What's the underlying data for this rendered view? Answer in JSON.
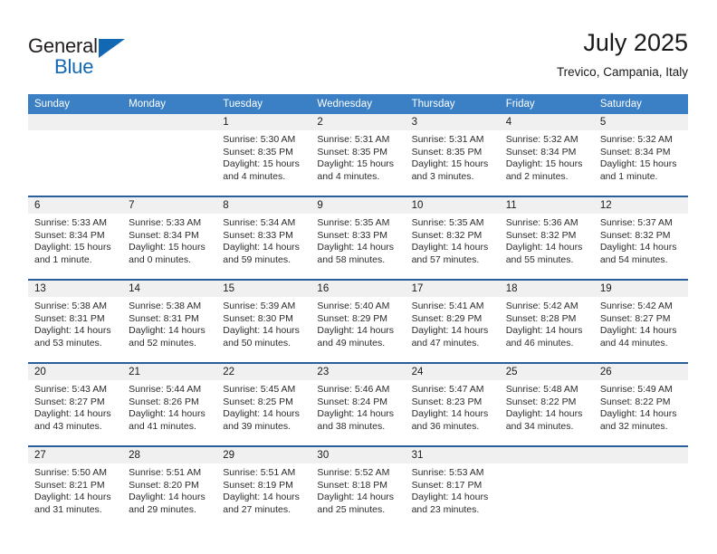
{
  "brand": {
    "name_part1": "General",
    "name_part2": "Blue",
    "triangle_color": "#1268b3",
    "text_color": "#231f20"
  },
  "header": {
    "title": "July 2025",
    "subtitle": "Trevico, Campania, Italy"
  },
  "theme": {
    "header_blue": "#3b7fc4",
    "row_rule_blue": "#2a6099",
    "daynum_band": "#f0f0f0",
    "background": "#ffffff"
  },
  "weekdays": [
    "Sunday",
    "Monday",
    "Tuesday",
    "Wednesday",
    "Thursday",
    "Friday",
    "Saturday"
  ],
  "labels": {
    "sunrise": "Sunrise:",
    "sunset": "Sunset:",
    "daylight": "Daylight:"
  },
  "weeks": [
    [
      {
        "day": "",
        "empty": true
      },
      {
        "day": "",
        "empty": true
      },
      {
        "day": "1",
        "sunrise": "Sunrise: 5:30 AM",
        "sunset": "Sunset: 8:35 PM",
        "daylight1": "Daylight: 15 hours",
        "daylight2": "and 4 minutes."
      },
      {
        "day": "2",
        "sunrise": "Sunrise: 5:31 AM",
        "sunset": "Sunset: 8:35 PM",
        "daylight1": "Daylight: 15 hours",
        "daylight2": "and 4 minutes."
      },
      {
        "day": "3",
        "sunrise": "Sunrise: 5:31 AM",
        "sunset": "Sunset: 8:35 PM",
        "daylight1": "Daylight: 15 hours",
        "daylight2": "and 3 minutes."
      },
      {
        "day": "4",
        "sunrise": "Sunrise: 5:32 AM",
        "sunset": "Sunset: 8:34 PM",
        "daylight1": "Daylight: 15 hours",
        "daylight2": "and 2 minutes."
      },
      {
        "day": "5",
        "sunrise": "Sunrise: 5:32 AM",
        "sunset": "Sunset: 8:34 PM",
        "daylight1": "Daylight: 15 hours",
        "daylight2": "and 1 minute."
      }
    ],
    [
      {
        "day": "6",
        "sunrise": "Sunrise: 5:33 AM",
        "sunset": "Sunset: 8:34 PM",
        "daylight1": "Daylight: 15 hours",
        "daylight2": "and 1 minute."
      },
      {
        "day": "7",
        "sunrise": "Sunrise: 5:33 AM",
        "sunset": "Sunset: 8:34 PM",
        "daylight1": "Daylight: 15 hours",
        "daylight2": "and 0 minutes."
      },
      {
        "day": "8",
        "sunrise": "Sunrise: 5:34 AM",
        "sunset": "Sunset: 8:33 PM",
        "daylight1": "Daylight: 14 hours",
        "daylight2": "and 59 minutes."
      },
      {
        "day": "9",
        "sunrise": "Sunrise: 5:35 AM",
        "sunset": "Sunset: 8:33 PM",
        "daylight1": "Daylight: 14 hours",
        "daylight2": "and 58 minutes."
      },
      {
        "day": "10",
        "sunrise": "Sunrise: 5:35 AM",
        "sunset": "Sunset: 8:32 PM",
        "daylight1": "Daylight: 14 hours",
        "daylight2": "and 57 minutes."
      },
      {
        "day": "11",
        "sunrise": "Sunrise: 5:36 AM",
        "sunset": "Sunset: 8:32 PM",
        "daylight1": "Daylight: 14 hours",
        "daylight2": "and 55 minutes."
      },
      {
        "day": "12",
        "sunrise": "Sunrise: 5:37 AM",
        "sunset": "Sunset: 8:32 PM",
        "daylight1": "Daylight: 14 hours",
        "daylight2": "and 54 minutes."
      }
    ],
    [
      {
        "day": "13",
        "sunrise": "Sunrise: 5:38 AM",
        "sunset": "Sunset: 8:31 PM",
        "daylight1": "Daylight: 14 hours",
        "daylight2": "and 53 minutes."
      },
      {
        "day": "14",
        "sunrise": "Sunrise: 5:38 AM",
        "sunset": "Sunset: 8:31 PM",
        "daylight1": "Daylight: 14 hours",
        "daylight2": "and 52 minutes."
      },
      {
        "day": "15",
        "sunrise": "Sunrise: 5:39 AM",
        "sunset": "Sunset: 8:30 PM",
        "daylight1": "Daylight: 14 hours",
        "daylight2": "and 50 minutes."
      },
      {
        "day": "16",
        "sunrise": "Sunrise: 5:40 AM",
        "sunset": "Sunset: 8:29 PM",
        "daylight1": "Daylight: 14 hours",
        "daylight2": "and 49 minutes."
      },
      {
        "day": "17",
        "sunrise": "Sunrise: 5:41 AM",
        "sunset": "Sunset: 8:29 PM",
        "daylight1": "Daylight: 14 hours",
        "daylight2": "and 47 minutes."
      },
      {
        "day": "18",
        "sunrise": "Sunrise: 5:42 AM",
        "sunset": "Sunset: 8:28 PM",
        "daylight1": "Daylight: 14 hours",
        "daylight2": "and 46 minutes."
      },
      {
        "day": "19",
        "sunrise": "Sunrise: 5:42 AM",
        "sunset": "Sunset: 8:27 PM",
        "daylight1": "Daylight: 14 hours",
        "daylight2": "and 44 minutes."
      }
    ],
    [
      {
        "day": "20",
        "sunrise": "Sunrise: 5:43 AM",
        "sunset": "Sunset: 8:27 PM",
        "daylight1": "Daylight: 14 hours",
        "daylight2": "and 43 minutes."
      },
      {
        "day": "21",
        "sunrise": "Sunrise: 5:44 AM",
        "sunset": "Sunset: 8:26 PM",
        "daylight1": "Daylight: 14 hours",
        "daylight2": "and 41 minutes."
      },
      {
        "day": "22",
        "sunrise": "Sunrise: 5:45 AM",
        "sunset": "Sunset: 8:25 PM",
        "daylight1": "Daylight: 14 hours",
        "daylight2": "and 39 minutes."
      },
      {
        "day": "23",
        "sunrise": "Sunrise: 5:46 AM",
        "sunset": "Sunset: 8:24 PM",
        "daylight1": "Daylight: 14 hours",
        "daylight2": "and 38 minutes."
      },
      {
        "day": "24",
        "sunrise": "Sunrise: 5:47 AM",
        "sunset": "Sunset: 8:23 PM",
        "daylight1": "Daylight: 14 hours",
        "daylight2": "and 36 minutes."
      },
      {
        "day": "25",
        "sunrise": "Sunrise: 5:48 AM",
        "sunset": "Sunset: 8:22 PM",
        "daylight1": "Daylight: 14 hours",
        "daylight2": "and 34 minutes."
      },
      {
        "day": "26",
        "sunrise": "Sunrise: 5:49 AM",
        "sunset": "Sunset: 8:22 PM",
        "daylight1": "Daylight: 14 hours",
        "daylight2": "and 32 minutes."
      }
    ],
    [
      {
        "day": "27",
        "sunrise": "Sunrise: 5:50 AM",
        "sunset": "Sunset: 8:21 PM",
        "daylight1": "Daylight: 14 hours",
        "daylight2": "and 31 minutes."
      },
      {
        "day": "28",
        "sunrise": "Sunrise: 5:51 AM",
        "sunset": "Sunset: 8:20 PM",
        "daylight1": "Daylight: 14 hours",
        "daylight2": "and 29 minutes."
      },
      {
        "day": "29",
        "sunrise": "Sunrise: 5:51 AM",
        "sunset": "Sunset: 8:19 PM",
        "daylight1": "Daylight: 14 hours",
        "daylight2": "and 27 minutes."
      },
      {
        "day": "30",
        "sunrise": "Sunrise: 5:52 AM",
        "sunset": "Sunset: 8:18 PM",
        "daylight1": "Daylight: 14 hours",
        "daylight2": "and 25 minutes."
      },
      {
        "day": "31",
        "sunrise": "Sunrise: 5:53 AM",
        "sunset": "Sunset: 8:17 PM",
        "daylight1": "Daylight: 14 hours",
        "daylight2": "and 23 minutes."
      },
      {
        "day": "",
        "empty": true
      },
      {
        "day": "",
        "empty": true
      }
    ]
  ]
}
